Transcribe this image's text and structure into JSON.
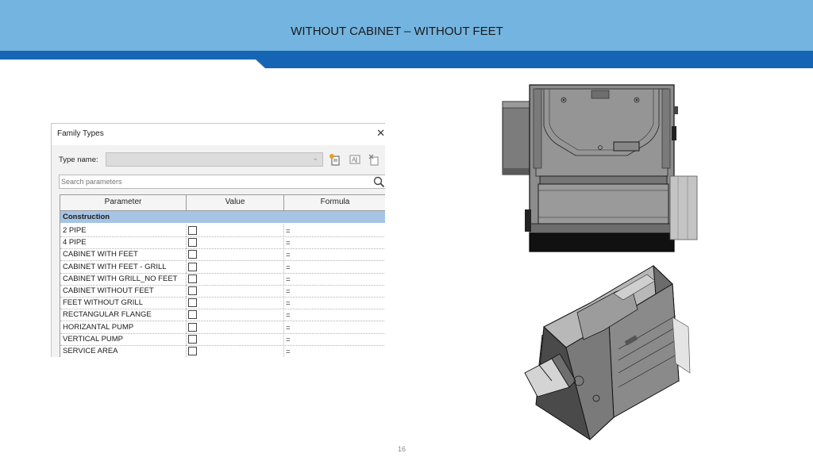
{
  "slide": {
    "title": "WITHOUT CABINET – WITHOUT FEET",
    "page_number": "16"
  },
  "dialog": {
    "title": "Family Types",
    "close_symbol": "✕",
    "type_name_label": "Type name:",
    "type_name_value": "",
    "search_placeholder": "Search parameters",
    "toolbar_icons": [
      "new-type-icon",
      "rename-type-icon",
      "delete-type-icon"
    ],
    "columns": [
      "Parameter",
      "Value",
      "Formula"
    ],
    "group": "Construction",
    "rows": [
      {
        "name": "2 PIPE",
        "checked": false,
        "formula": "="
      },
      {
        "name": "4 PIPE",
        "checked": false,
        "formula": "="
      },
      {
        "name": "CABINET WITH FEET",
        "checked": false,
        "formula": "="
      },
      {
        "name": "CABINET WITH FEET - GRILL",
        "checked": false,
        "formula": "="
      },
      {
        "name": "CABINET WITH GRILL_NO FEET",
        "checked": false,
        "formula": "="
      },
      {
        "name": "CABINET WITHOUT FEET",
        "checked": false,
        "formula": "="
      },
      {
        "name": "FEET WITHOUT GRILL",
        "checked": false,
        "formula": "="
      },
      {
        "name": "RECTANGULAR FLANGE",
        "checked": false,
        "formula": "="
      },
      {
        "name": "HORIZANTAL PUMP",
        "checked": false,
        "formula": "="
      },
      {
        "name": "VERTICAL PUMP",
        "checked": false,
        "formula": "="
      },
      {
        "name": "SERVICE AREA",
        "checked": false,
        "formula": "="
      }
    ]
  },
  "images": {
    "front_view": "fan-coil-unit-front-view",
    "iso_view": "fan-coil-unit-isometric-view"
  },
  "colors": {
    "banner": "#74b4e0",
    "stripe": "#1565b4",
    "group_header": "#a6c4e4",
    "cad_gray": "#8a8a8a"
  }
}
